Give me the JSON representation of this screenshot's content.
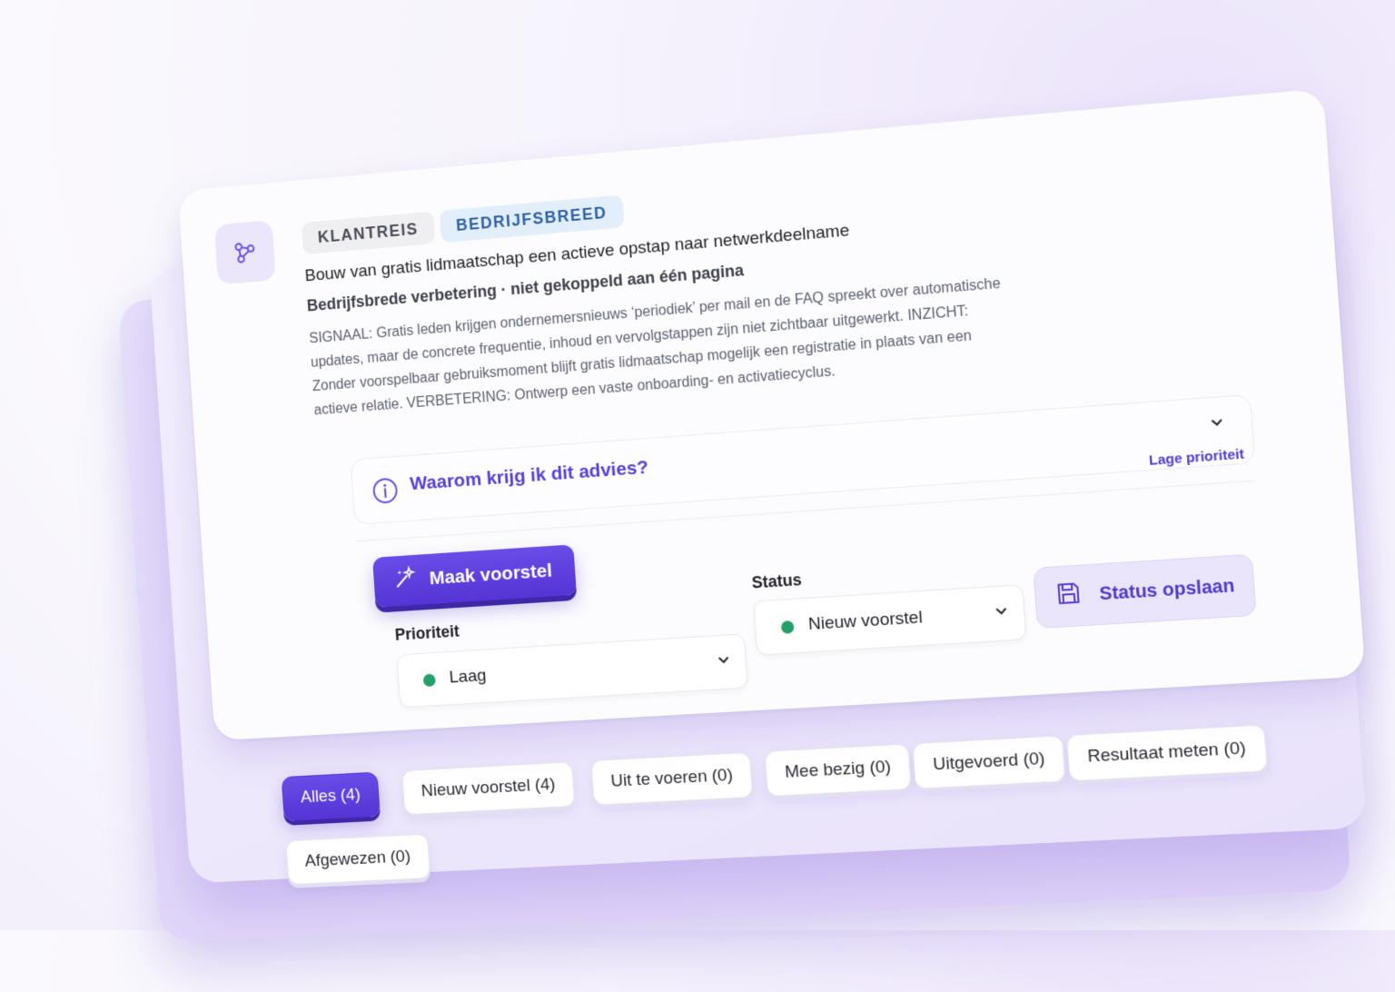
{
  "card": {
    "tags": [
      "KLANTREIS",
      "BEDRIJFSBREED"
    ],
    "title": "Bouw van gratis lidmaatschap een actieve opstap naar netwerkdeelname",
    "subtitle": "Bedrijfsbrede verbetering · niet gekoppeld aan één pagina",
    "body": "SIGNAAL: Gratis leden krijgen ondernemersnieuws ‘periodiek’ per mail en de FAQ spreekt over automatische updates, maar de concrete frequentie, inhoud en vervolgstappen zijn niet zichtbaar uitgewerkt. INZICHT: Zonder voorspelbaar gebruiksmoment blijft gratis lidmaatschap mogelijk een registratie in plaats van een actieve relatie. VERBETERING: Ontwerp een vaste onboarding- en activatiecyclus.",
    "advies_question": "Waarom krijg ik dit advies?",
    "priority_badge": "Lage prioriteit",
    "primary_button": "Maak voorstel",
    "priority_label": "Prioriteit",
    "priority_value": "Laag",
    "status_label": "Status",
    "status_value": "Nieuw voorstel",
    "save_button": "Status opslaan"
  },
  "filters": [
    {
      "label": "Alles (4)",
      "active": true
    },
    {
      "label": "Nieuw voorstel (4)",
      "active": false
    },
    {
      "label": "Uit te voeren (0)",
      "active": false
    },
    {
      "label": "Mee bezig (0)",
      "active": false
    },
    {
      "label": "Uitgevoerd (0)",
      "active": false
    },
    {
      "label": "Resultaat meten (0)",
      "active": false
    },
    {
      "label": "Afgewezen (0)",
      "active": false
    }
  ],
  "colors": {
    "accent": "#5434d4",
    "status_dot": "#23a06a",
    "tag_blue": "#2e62a5"
  },
  "icons": {
    "tile": "share-network-icon",
    "info": "info-icon",
    "expand": "chevron-down-icon",
    "magic": "magic-wand-icon",
    "save": "floppy-disk-icon"
  }
}
